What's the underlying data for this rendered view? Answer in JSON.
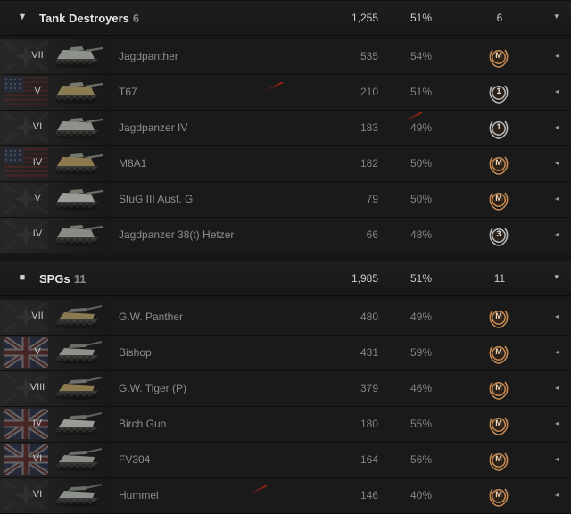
{
  "groups": [
    {
      "toggle": "▼",
      "title": "Tank Destroyers",
      "count": "6",
      "battles": "1,255",
      "win": "51%",
      "mastery": "6",
      "rows": [
        {
          "tier": "VII",
          "name": "Jagdpanther",
          "battles": "535",
          "win": "54%",
          "badge": "M",
          "nation": "germany",
          "icon": "td-tank-icon"
        },
        {
          "tier": "V",
          "name": "T67",
          "battles": "210",
          "win": "51%",
          "badge": "1",
          "nation": "usa",
          "icon": "td-tank-icon"
        },
        {
          "tier": "VI",
          "name": "Jagdpanzer IV",
          "battles": "183",
          "win": "49%",
          "badge": "1",
          "nation": "germany",
          "icon": "td-tank-icon"
        },
        {
          "tier": "IV",
          "name": "M8A1",
          "battles": "182",
          "win": "50%",
          "badge": "M",
          "nation": "usa",
          "icon": "td-tank-icon"
        },
        {
          "tier": "V",
          "name": "StuG III Ausf. G",
          "battles": "79",
          "win": "50%",
          "badge": "M",
          "nation": "germany",
          "icon": "td-tank-icon"
        },
        {
          "tier": "IV",
          "name": "Jagdpanzer 38(t) Hetzer",
          "battles": "66",
          "win": "48%",
          "badge": "3",
          "nation": "germany",
          "icon": "td-tank-icon"
        }
      ]
    },
    {
      "toggle": "■",
      "title": "SPGs",
      "count": "11",
      "battles": "1,985",
      "win": "51%",
      "mastery": "11",
      "rows": [
        {
          "tier": "VII",
          "name": "G.W. Panther",
          "battles": "480",
          "win": "49%",
          "badge": "M",
          "nation": "germany",
          "icon": "spg-icon"
        },
        {
          "tier": "V",
          "name": "Bishop",
          "battles": "431",
          "win": "59%",
          "badge": "M",
          "nation": "uk",
          "icon": "spg-icon"
        },
        {
          "tier": "VIII",
          "name": "G.W. Tiger (P)",
          "battles": "379",
          "win": "46%",
          "badge": "M",
          "nation": "germany",
          "icon": "spg-icon"
        },
        {
          "tier": "IV",
          "name": "Birch Gun",
          "battles": "180",
          "win": "55%",
          "badge": "M",
          "nation": "uk",
          "icon": "spg-icon"
        },
        {
          "tier": "VI",
          "name": "FV304",
          "battles": "164",
          "win": "56%",
          "badge": "M",
          "nation": "uk",
          "icon": "spg-icon"
        },
        {
          "tier": "VI",
          "name": "Hummel",
          "battles": "146",
          "win": "40%",
          "badge": "M",
          "nation": "germany",
          "icon": "spg-icon"
        }
      ]
    }
  ],
  "row_expand_glyph": "◂",
  "header_expand_glyph": "▾",
  "colors": {
    "accent_red": "#b8261a",
    "badge_gold": "#c98a52",
    "badge_silver": "#b9b9b9"
  }
}
